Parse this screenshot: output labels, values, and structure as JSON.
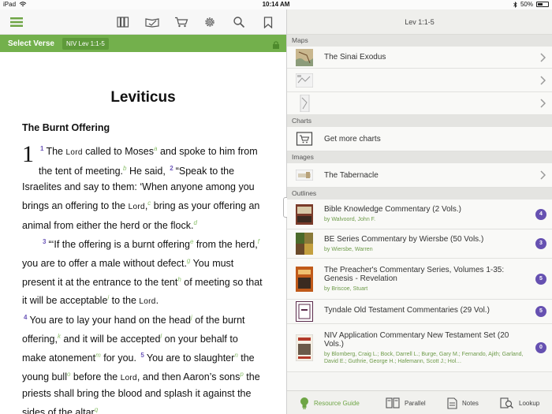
{
  "status": {
    "device": "iPad",
    "time": "10:14 AM",
    "battery": "50%",
    "battery_level": 0.5
  },
  "toolbar": {
    "icons": [
      "menu-icon",
      "library-icon",
      "reading-plan-icon",
      "cart-icon",
      "gear-icon",
      "search-icon",
      "bookmark-icon"
    ]
  },
  "verse_bar": {
    "select_label": "Select Verse",
    "reference": "NIV Lev 1:1-5"
  },
  "bible": {
    "book": "Leviticus",
    "section": "The Burnt Offering",
    "chapter": "1",
    "v1": {
      "num": "1",
      "t1": "The ",
      "lord1": "Lord",
      "t2": " called to Moses",
      "fa": "a",
      "t3": " and spoke to him from the tent of meeting.",
      "fb": "b",
      "t4": " He said, "
    },
    "v2": {
      "num": "2",
      "t1": "“Speak to the Israelites and say to them: ‘When anyone among you brings an offering to the ",
      "lord": "Lord",
      "t2": ",",
      "fc": "c",
      "t3": " bring as your offering an animal from either the herd or the flock.",
      "fd": "d"
    },
    "v3": {
      "num": "3",
      "t1": "“‘If the offering is a burnt offering",
      "fe": "e",
      "t2": " from the herd,",
      "ff": "f",
      "t3": " you are to offer a male without defect.",
      "fg": "g",
      "t4": " You must present it at the entrance to the tent",
      "fh": "h",
      "t5": " of meeting so that it will be acceptable",
      "fi": "i",
      "t6": " to the ",
      "lord": "Lord",
      "t7": "."
    },
    "v4": {
      "num": "4",
      "t1": "You are to lay your hand on the head",
      "fj": "j",
      "t2": " of the burnt offering,",
      "fk": "k",
      "t3": " and it will be accepted",
      "fl": "l",
      "t4": " on your behalf to make atonement",
      "fm": "m",
      "t5": " for you. "
    },
    "v5": {
      "num": "5",
      "t1": "You are to slaughter",
      "fn": "n",
      "t2": " the young bull",
      "fo": "o",
      "t3": " before the ",
      "lord": "Lord",
      "t4": ", and then Aaron’s sons",
      "fp": "p",
      "t5": " the priests shall bring the blood and splash it against the sides of the altar",
      "fq": "q"
    }
  },
  "resource_guide": {
    "header": "Lev 1:1-5",
    "maps_label": "Maps",
    "maps": [
      {
        "title": "The Sinai Exodus"
      },
      {
        "title": ""
      },
      {
        "title": ""
      }
    ],
    "charts_label": "Charts",
    "charts_item": "Get more charts",
    "images_label": "Images",
    "images_item": "The Tabernacle",
    "outlines_label": "Outlines",
    "outlines": [
      {
        "title": "Bible Knowledge Commentary (2 Vols.)",
        "by": "by Walvoord, John F.",
        "count": "4"
      },
      {
        "title": "BE Series Commentary by Wiersbe (50 Vols.)",
        "by": "by Wiersbe, Warren",
        "count": "3"
      },
      {
        "title": "The Preacher's Commentary Series, Volumes 1-35: Genesis - Revelation",
        "by": "by Briscoe, Stuart",
        "count": "5"
      },
      {
        "title": "Tyndale Old Testament Commentaries (29 Vol.)",
        "by": "",
        "count": "5"
      },
      {
        "title": "NIV Application Commentary New Testament Set (20 Vols.)",
        "by": "by Blomberg, Craig L.; Bock, Darrell L.; Burge, Gary M.; Fernando, Ajith; Garland, David E.; Guthrie, George H.; Hafemann, Scott J.; Hol…",
        "count": "0"
      }
    ]
  },
  "tabs": [
    {
      "label": "Resource Guide",
      "icon": "lightbulb-icon"
    },
    {
      "label": "Parallel",
      "icon": "parallel-books-icon"
    },
    {
      "label": "Notes",
      "icon": "notes-icon"
    },
    {
      "label": "Lookup",
      "icon": "lookup-icon"
    }
  ],
  "colors": {
    "accent_green": "#73b04c",
    "badge_purple": "#6651b1",
    "verse_number": "#6b55b8",
    "footnote_green": "#8abf6a"
  }
}
